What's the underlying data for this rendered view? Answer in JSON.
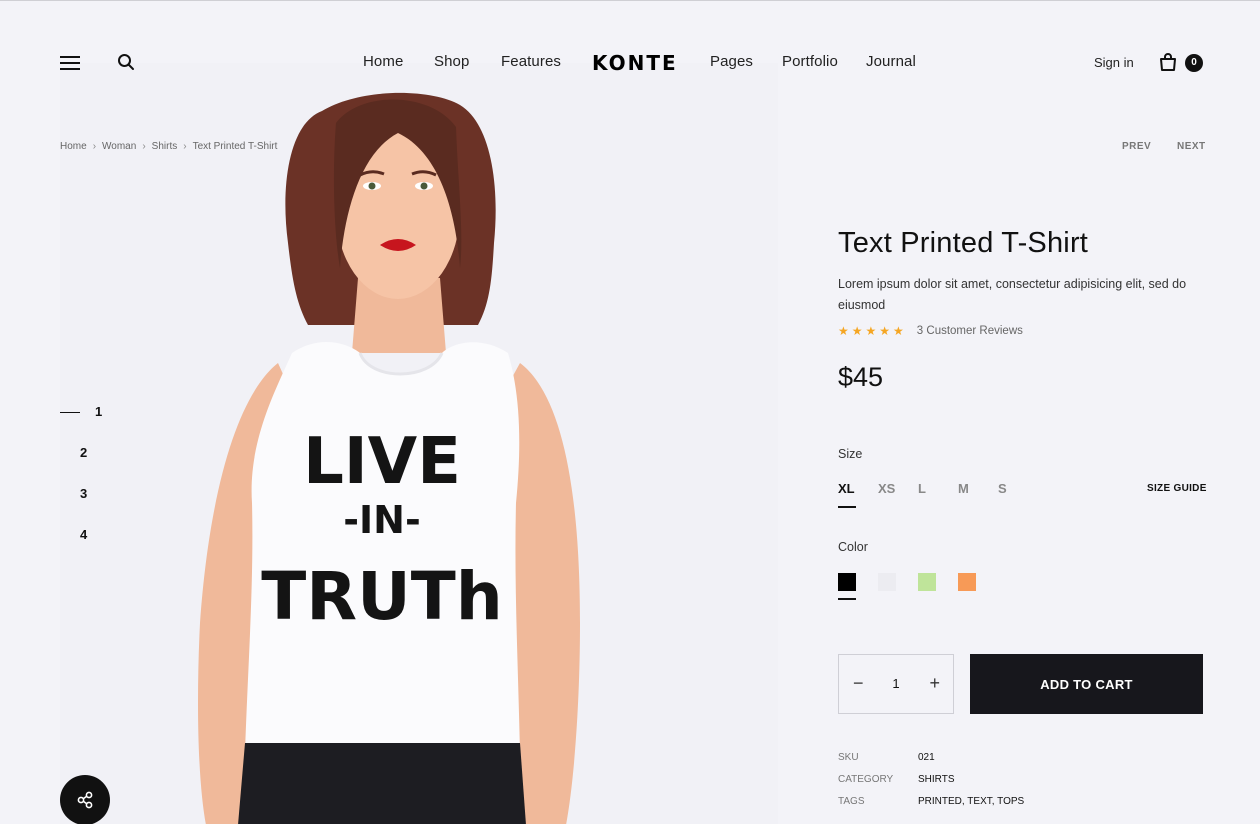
{
  "header": {
    "logo": "KONTE",
    "nav": [
      "Home",
      "Shop",
      "Features",
      "Pages",
      "Portfolio",
      "Journal"
    ],
    "sign_in": "Sign in",
    "cart_count": "0"
  },
  "breadcrumb": [
    "Home",
    "Woman",
    "Shirts",
    "Text Printed T-Shirt"
  ],
  "pager": {
    "prev": "PREV",
    "next": "NEXT"
  },
  "gallery": {
    "slides": [
      "1",
      "2",
      "3",
      "4"
    ],
    "active_slide": 1
  },
  "product": {
    "title": "Text Printed T-Shirt",
    "description": "Lorem ipsum dolor sit amet, consectetur adipisicing elit, sed do eiusmod",
    "stars": "★★★★★",
    "rating": 5,
    "reviews": "3 Customer Reviews",
    "price": "$45",
    "size_label": "Size",
    "sizes": [
      "XL",
      "XS",
      "L",
      "M",
      "S"
    ],
    "selected_size": "XL",
    "size_guide": "SIZE GUIDE",
    "color_label": "Color",
    "colors": [
      "#000000",
      "#ececf1",
      "#bfe49a",
      "#f79a57"
    ],
    "quantity": "1",
    "add_to_cart": "ADD TO CART",
    "sku_label": "SKU",
    "sku": "021",
    "category_label": "CATEGORY",
    "category": "SHIRTS",
    "tags_label": "TAGS",
    "tags": [
      "PRINTED",
      "TEXT",
      "TOPS"
    ]
  },
  "shirt_print": [
    "LIVE",
    "-IN-",
    "TRUTh"
  ]
}
